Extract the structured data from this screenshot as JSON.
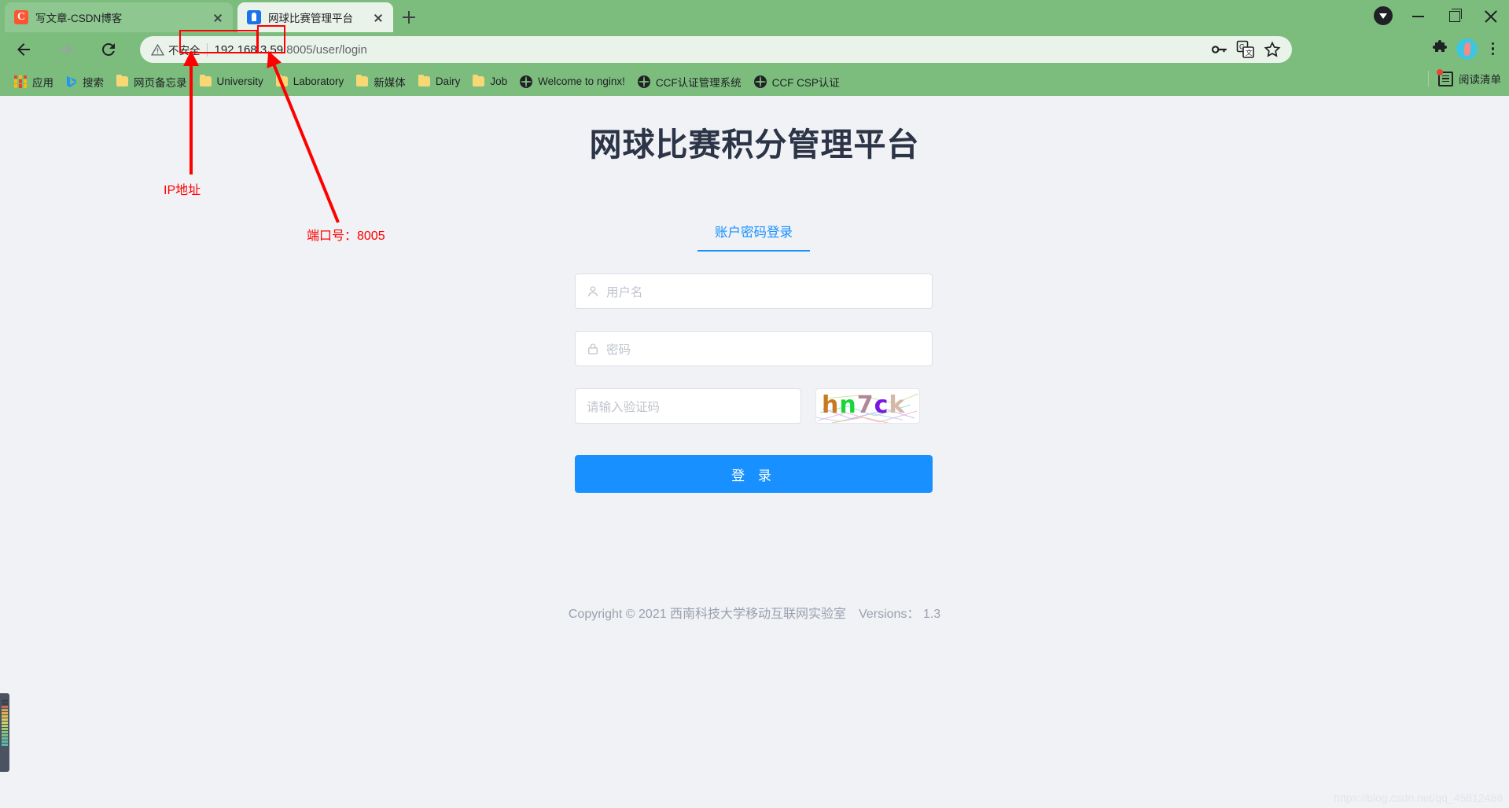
{
  "browser": {
    "tabs": [
      {
        "title": "写文章-CSDN博客",
        "favicon": "csdn-icon",
        "active": false
      },
      {
        "title": "网球比赛管理平台",
        "favicon": "tennis-app-icon",
        "active": true
      }
    ],
    "newtab_label": "+",
    "nav": {
      "back": "back-arrow-icon",
      "forward": "forward-arrow-icon",
      "reload": "reload-icon",
      "home": "home-icon"
    },
    "omnibox": {
      "security_label": "不安全",
      "url_host": "192.168.3.59",
      "url_port": ":8005",
      "url_path": "/user/login",
      "full_url": "192.168.3.59:8005/user/login"
    },
    "toolbar_icons": [
      "key-icon",
      "translate-icon",
      "star-icon",
      "extensions-puzzle-icon",
      "profile-avatar",
      "chrome-menu-icon"
    ],
    "window_controls": [
      "download-icon",
      "minimize-icon",
      "maximize-icon",
      "close-icon"
    ],
    "bookmarks": [
      {
        "label": "应用",
        "icon": "apps-grid-icon"
      },
      {
        "label": "搜索",
        "icon": "bing-icon"
      },
      {
        "label": "网页备忘录",
        "icon": "folder-icon"
      },
      {
        "label": "University",
        "icon": "folder-icon"
      },
      {
        "label": "Laboratory",
        "icon": "folder-icon"
      },
      {
        "label": "新媒体",
        "icon": "folder-icon"
      },
      {
        "label": "Dairy",
        "icon": "folder-icon"
      },
      {
        "label": "Job",
        "icon": "folder-icon"
      },
      {
        "label": "Welcome to nginx!",
        "icon": "globe-icon"
      },
      {
        "label": "CCF认证管理系统",
        "icon": "globe-icon"
      },
      {
        "label": "CCF CSP认证",
        "icon": "globe-icon"
      }
    ],
    "reading_list_label": "阅读清单"
  },
  "page": {
    "title": "网球比赛积分管理平台",
    "login_tab": "账户密码登录",
    "username": {
      "placeholder": "用户名",
      "value": "",
      "icon": "user-icon"
    },
    "password": {
      "placeholder": "密码",
      "value": "",
      "icon": "lock-icon"
    },
    "captcha": {
      "placeholder": "请输入验证码",
      "value": "",
      "image_text": [
        "h",
        "n",
        "7",
        "c",
        "k"
      ],
      "image_text_joined": "hn7ck"
    },
    "login_button": "登 录",
    "footer": {
      "copyright": "Copyright © 2021 西南科技大学移动互联网实验室",
      "versions": "Versions： 1.3"
    },
    "watermark": "https://blog.csdn.net/qq_45812488"
  },
  "annotations": [
    {
      "label": "IP地址",
      "target": "url-host"
    },
    {
      "label": "端口号：8005",
      "target": "url-port"
    }
  ],
  "colors": {
    "chrome_bg": "#7cbd7e",
    "tab_active": "#eaf3ea",
    "page_bg": "#f0f2f5",
    "accent_blue": "#1890ff",
    "annotation_red": "#ff0000",
    "title_text": "#2c3447"
  }
}
